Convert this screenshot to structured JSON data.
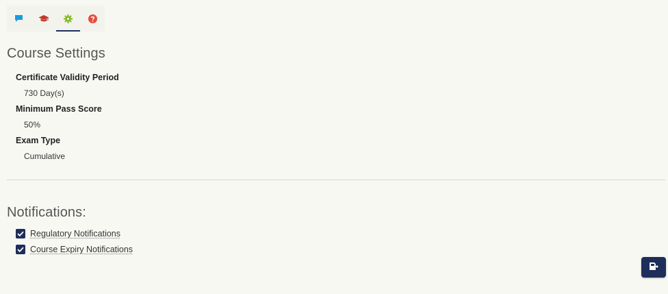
{
  "tabs": [
    {
      "icon": "chat-icon",
      "color": "#1a9ae0"
    },
    {
      "icon": "graduation-cap-icon",
      "color": "#c0392b"
    },
    {
      "icon": "gear-icon",
      "color": "#7cb518",
      "active": true
    },
    {
      "icon": "help-icon",
      "color": "#e74c3c"
    }
  ],
  "settings": {
    "title": "Course Settings",
    "fields": [
      {
        "label": "Certificate Validity Period",
        "value": "730 Day(s)"
      },
      {
        "label": "Minimum Pass Score",
        "value": "50%"
      },
      {
        "label": "Exam Type",
        "value": "Cumulative"
      }
    ]
  },
  "notifications": {
    "title": "Notifications:",
    "items": [
      {
        "label": "Regulatory Notifications",
        "checked": true
      },
      {
        "label": "Course Expiry Notifications",
        "checked": true
      }
    ]
  },
  "save_button": {
    "icon": "save-icon"
  },
  "colors": {
    "accent": "#1e2d5a",
    "background": "#f8f8f3"
  }
}
